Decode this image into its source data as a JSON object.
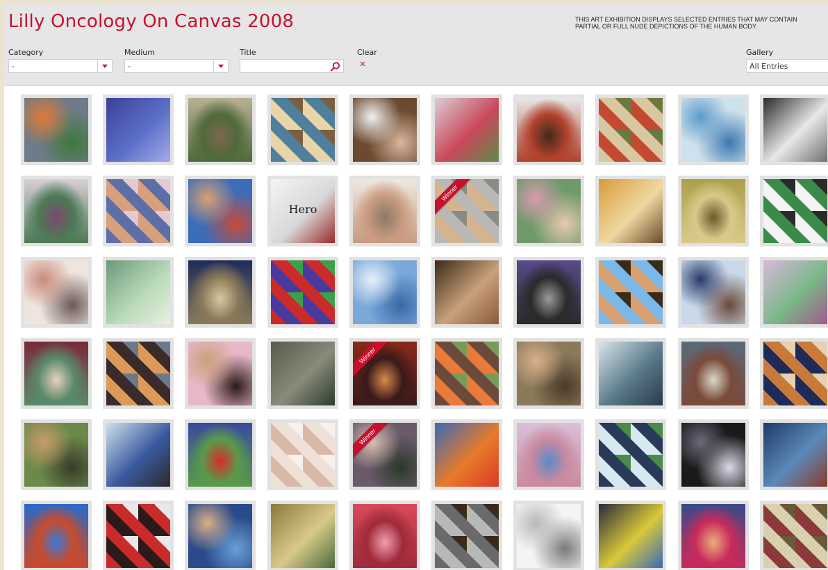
{
  "header": {
    "title": "Lilly Oncology On Canvas 2008",
    "disclaimer_line1": "THIS ART EXHIBITION DISPLAYS SELECTED ENTRIES THAT MAY CONTAIN",
    "disclaimer_line2": "PARTIAL OR FULL NUDE DEPICTIONS OF THE HUMAN BODY."
  },
  "filters": {
    "category": {
      "label": "Category",
      "value": "-"
    },
    "medium": {
      "label": "Medium",
      "value": "-"
    },
    "title": {
      "label": "Title",
      "value": "",
      "placeholder": ""
    },
    "clear": {
      "label": "Clear",
      "icon": "close-icon"
    },
    "gallery": {
      "label": "Gallery",
      "value": "All Entries"
    }
  },
  "colors": {
    "brand_red": "#c8102e",
    "header_bg": "#e6e6e6",
    "tile_frame": "#e2e2e2"
  },
  "gallery": {
    "winner_label": "Winner",
    "tiles": [
      {
        "c1": "#6e7b88",
        "c2": "#e07a33",
        "c3": "#3c7a3a",
        "w": false
      },
      {
        "c1": "#3d3f9a",
        "c2": "#5b6fc7",
        "c3": "#a6a9e8",
        "w": false
      },
      {
        "c1": "#b8b094",
        "c2": "#7d6650",
        "c3": "#4f6a3b",
        "w": false
      },
      {
        "c1": "#4f7f9a",
        "c2": "#e8d4a8",
        "c3": "#7a6040",
        "w": false
      },
      {
        "c1": "#6b4a30",
        "c2": "#f2f2f2",
        "c3": "#d9b7a0",
        "w": false
      },
      {
        "c1": "#d9cfd6",
        "c2": "#c9485a",
        "c3": "#5f8a4a",
        "w": false
      },
      {
        "c1": "#e8e8e8",
        "c2": "#3f2a1e",
        "c3": "#b0412c",
        "w": false
      },
      {
        "c1": "#d9c7a2",
        "c2": "#c24a32",
        "c3": "#6a7a3e",
        "w": false
      },
      {
        "c1": "#cfe1ec",
        "c2": "#5b9bc9",
        "c3": "#3a78b0",
        "w": false
      },
      {
        "c1": "#2a2a2a",
        "c2": "#e8e8e8",
        "c3": "#707070",
        "w": false
      },
      {
        "c1": "#d8cfd8",
        "c2": "#7a4a6e",
        "c3": "#4d7a55",
        "w": false
      },
      {
        "c1": "#5e6fa6",
        "c2": "#d9a080",
        "c3": "#e3c9d4",
        "w": false
      },
      {
        "c1": "#3b6db8",
        "c2": "#d9a070",
        "c3": "#c94a3a",
        "w": false
      },
      {
        "c1": "#f4f4f4",
        "c2": "#d8d8d8",
        "c3": "#9a2a2a",
        "w": false,
        "text": "Hero"
      },
      {
        "c1": "#efe8df",
        "c2": "#8a7a66",
        "c3": "#c99a80",
        "w": false
      },
      {
        "c1": "#b9b8b4",
        "c2": "#d6b48e",
        "c3": "#8a8a86",
        "w": true
      },
      {
        "c1": "#6e9a6a",
        "c2": "#d99ab0",
        "c3": "#e8c9b0",
        "w": false
      },
      {
        "c1": "#d99a3a",
        "c2": "#f0d8a0",
        "c3": "#6a4a2a",
        "w": false
      },
      {
        "c1": "#a9a04a",
        "c2": "#6a5a2a",
        "c3": "#d9c98a",
        "w": false
      },
      {
        "c1": "#3a8a4a",
        "c2": "#f4f4f4",
        "c3": "#2a2a2a",
        "w": false
      },
      {
        "c1": "#efe4de",
        "c2": "#c98a7a",
        "c3": "#6a5a5a",
        "w": false
      },
      {
        "c1": "#6a9a7a",
        "c2": "#b9d9b8",
        "c3": "#e8f0e0",
        "w": false
      },
      {
        "c1": "#1e2a5a",
        "c2": "#d9c9a0",
        "c3": "#8a7a5a",
        "w": false
      },
      {
        "c1": "#c92a2a",
        "c2": "#4a3aa0",
        "c3": "#3aa04a",
        "w": false
      },
      {
        "c1": "#7aa8d9",
        "c2": "#e8f0f8",
        "c3": "#3a68a8",
        "w": false
      },
      {
        "c1": "#3a2a1a",
        "c2": "#c9a07a",
        "c3": "#8a5a3a",
        "w": false
      },
      {
        "c1": "#5a4a8a",
        "c2": "#9a9a9a",
        "c3": "#2a2a2a",
        "w": false
      },
      {
        "c1": "#7ab8e8",
        "c2": "#d9a070",
        "c3": "#3a2a1a",
        "w": false
      },
      {
        "c1": "#c9d9ea",
        "c2": "#2a3a6a",
        "c3": "#6a4a3a",
        "w": false
      },
      {
        "c1": "#d9b8d9",
        "c2": "#7ab88a",
        "c3": "#a05a8a",
        "w": false
      },
      {
        "c1": "#7a2a3a",
        "c2": "#e8d0c0",
        "c3": "#5a8a6a",
        "w": false
      },
      {
        "c1": "#3a2a2a",
        "c2": "#d99a5a",
        "c3": "#6a7a8a",
        "w": false
      },
      {
        "c1": "#e8b8c8",
        "c2": "#c9a07a",
        "c3": "#2a1a1a",
        "w": false
      },
      {
        "c1": "#5a5a4a",
        "c2": "#8a8a7a",
        "c3": "#2a3a2a",
        "w": false
      },
      {
        "c1": "#8a2a1a",
        "c2": "#d98a4a",
        "c3": "#3a1a1a",
        "w": true
      },
      {
        "c1": "#6a4a3a",
        "c2": "#e87a3a",
        "c3": "#7a9a5a",
        "w": false
      },
      {
        "c1": "#8a7a5a",
        "c2": "#d9b08a",
        "c3": "#4a3a2a",
        "w": false
      },
      {
        "c1": "#d9e4ea",
        "c2": "#5a7a8a",
        "c3": "#2a3a4a",
        "w": false
      },
      {
        "c1": "#5a6a7a",
        "c2": "#d9d9c9",
        "c3": "#7a4a3a",
        "w": false
      },
      {
        "c1": "#c97a3a",
        "c2": "#1e2a5a",
        "c3": "#e8d0b0",
        "w": false
      },
      {
        "c1": "#6a8a4a",
        "c2": "#c99a6a",
        "c3": "#3a3a2a",
        "w": false
      },
      {
        "c1": "#cfe0ea",
        "c2": "#3a5aa0",
        "c3": "#2a2a2a",
        "w": false
      },
      {
        "c1": "#3a4aa0",
        "c2": "#d92a2a",
        "c3": "#5a9a4a",
        "w": false
      },
      {
        "c1": "#efe0d8",
        "c2": "#d9b8a8",
        "c3": "#f8f0ea",
        "w": false
      },
      {
        "c1": "#6a5a6a",
        "c2": "#d9c0b0",
        "c3": "#2a3a2a",
        "w": true
      },
      {
        "c1": "#3a6ab8",
        "c2": "#e87a2a",
        "c3": "#d93a2a",
        "w": false
      },
      {
        "c1": "#d9c0d8",
        "c2": "#5a8ac9",
        "c3": "#c98aa0",
        "w": false
      },
      {
        "c1": "#2a3a5a",
        "c2": "#d9e8f0",
        "c3": "#4a8a4a",
        "w": false
      },
      {
        "c1": "#1a1a1a",
        "c2": "#6a6a7a",
        "c3": "#d9d9e8",
        "w": false
      },
      {
        "c1": "#1e3a6a",
        "c2": "#5a8ab8",
        "c3": "#8a3a2a",
        "w": false
      },
      {
        "c1": "#2a6ac9",
        "c2": "#3a7ad9",
        "c3": "#c94a2a",
        "w": false
      },
      {
        "c1": "#c92a2a",
        "c2": "#2a1a1a",
        "c3": "#e8e8e8",
        "w": false
      },
      {
        "c1": "#2a4a8a",
        "c2": "#d9b08a",
        "c3": "#6aa0d9",
        "w": false
      },
      {
        "c1": "#8a7a3a",
        "c2": "#d9c98a",
        "c3": "#4a6a3a",
        "w": false
      },
      {
        "c1": "#d94a5a",
        "c2": "#f0a0b0",
        "c3": "#a02a3a",
        "w": false
      },
      {
        "c1": "#6a6a6a",
        "c2": "#b8b8b8",
        "c3": "#3a2a1a",
        "w": false
      },
      {
        "c1": "#f4f4f4",
        "c2": "#b8b8b8",
        "c3": "#7a7a7a",
        "w": false
      },
      {
        "c1": "#2a2a3a",
        "c2": "#d9c93a",
        "c3": "#3a6ab8",
        "w": false
      },
      {
        "c1": "#3a4a8a",
        "c2": "#e8b07a",
        "c3": "#c92a5a",
        "w": false
      },
      {
        "c1": "#d9d0b0",
        "c2": "#8a3a3a",
        "c3": "#6a5a3a",
        "w": false
      }
    ]
  }
}
